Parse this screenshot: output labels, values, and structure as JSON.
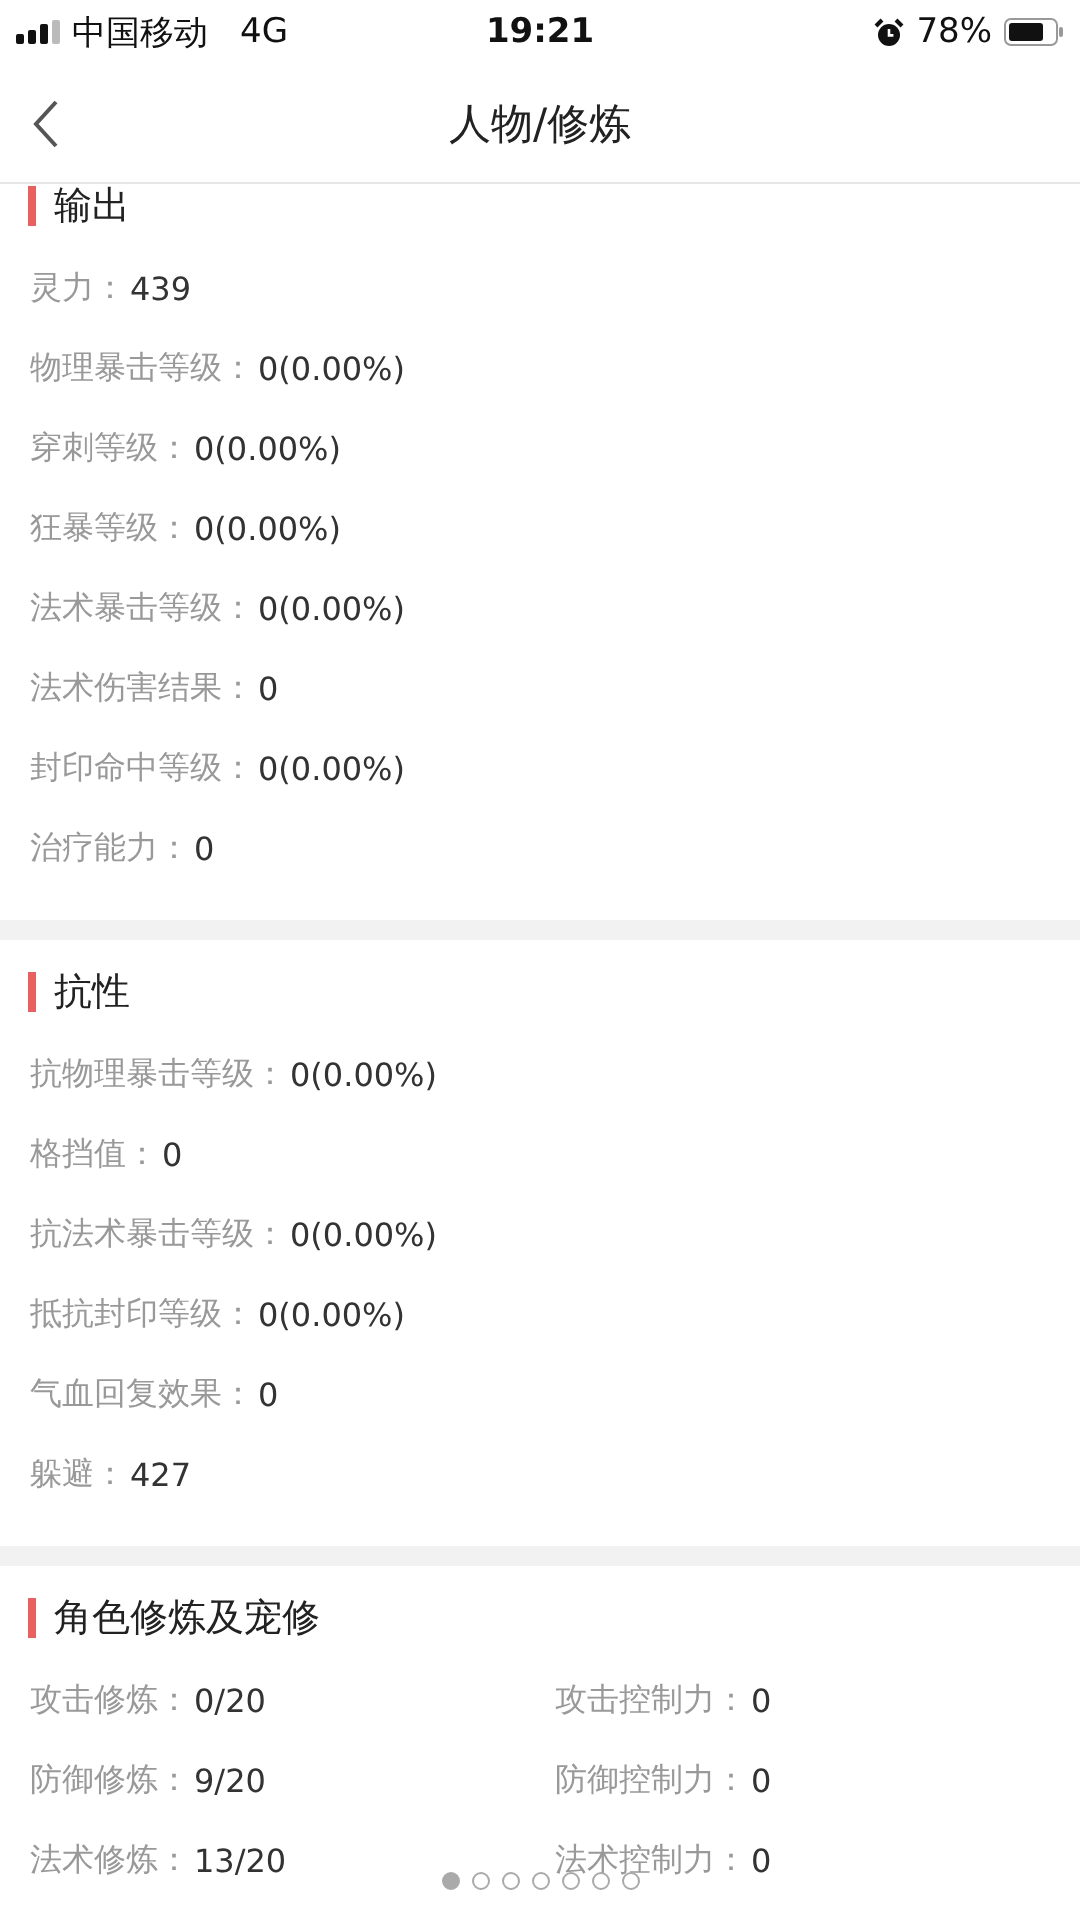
{
  "status_bar": {
    "carrier": "中国移动",
    "network": "4G",
    "time": "19:21",
    "battery": "78%"
  },
  "nav": {
    "title": "人物/修炼"
  },
  "sections": [
    {
      "title": "输出",
      "kind": "list",
      "stats": [
        {
          "label": "灵力：",
          "value": "439"
        },
        {
          "label": "物理暴击等级：",
          "value": "0(0.00%)"
        },
        {
          "label": "穿刺等级：",
          "value": "0(0.00%)"
        },
        {
          "label": "狂暴等级：",
          "value": "0(0.00%)"
        },
        {
          "label": "法术暴击等级：",
          "value": "0(0.00%)"
        },
        {
          "label": "法术伤害结果：",
          "value": "0"
        },
        {
          "label": "封印命中等级：",
          "value": "0(0.00%)"
        },
        {
          "label": "治疗能力：",
          "value": "0"
        }
      ]
    },
    {
      "title": "抗性",
      "kind": "list",
      "stats": [
        {
          "label": "抗物理暴击等级：",
          "value": "0(0.00%)"
        },
        {
          "label": "格挡值：",
          "value": "0"
        },
        {
          "label": "抗法术暴击等级：",
          "value": "0(0.00%)"
        },
        {
          "label": "抵抗封印等级：",
          "value": "0(0.00%)"
        },
        {
          "label": "气血回复效果：",
          "value": "0"
        },
        {
          "label": "躲避：",
          "value": "427"
        }
      ]
    },
    {
      "title": "角色修炼及宠修",
      "kind": "grid",
      "stats": [
        {
          "label": "攻击修炼：",
          "value": "0/20"
        },
        {
          "label": "攻击控制力：",
          "value": "0"
        },
        {
          "label": "防御修炼：",
          "value": "9/20"
        },
        {
          "label": "防御控制力：",
          "value": "0"
        },
        {
          "label": "法术修炼：",
          "value": "13/20"
        },
        {
          "label": "法术控制力：",
          "value": "0"
        }
      ]
    }
  ],
  "page_dots": [
    {
      "selected": true
    },
    {
      "selected": false
    },
    {
      "selected": false
    },
    {
      "selected": false
    },
    {
      "selected": false
    },
    {
      "selected": false
    },
    {
      "selected": false
    }
  ]
}
